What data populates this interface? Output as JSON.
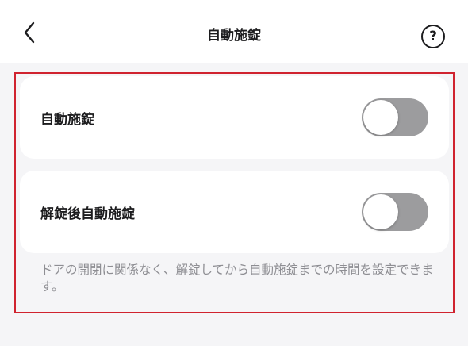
{
  "header": {
    "title": "自動施錠",
    "help_glyph": "?"
  },
  "settings": [
    {
      "label": "自動施錠",
      "toggle_on": false
    },
    {
      "label": "解錠後自動施錠",
      "toggle_on": false
    }
  ],
  "description": "ドアの開閉に関係なく、解錠してから自動施錠までの時間を設定できます。",
  "colors": {
    "toggle_off": "#9c9c9e",
    "highlight_frame": "#d0232f",
    "background": "#f5f5f7"
  }
}
